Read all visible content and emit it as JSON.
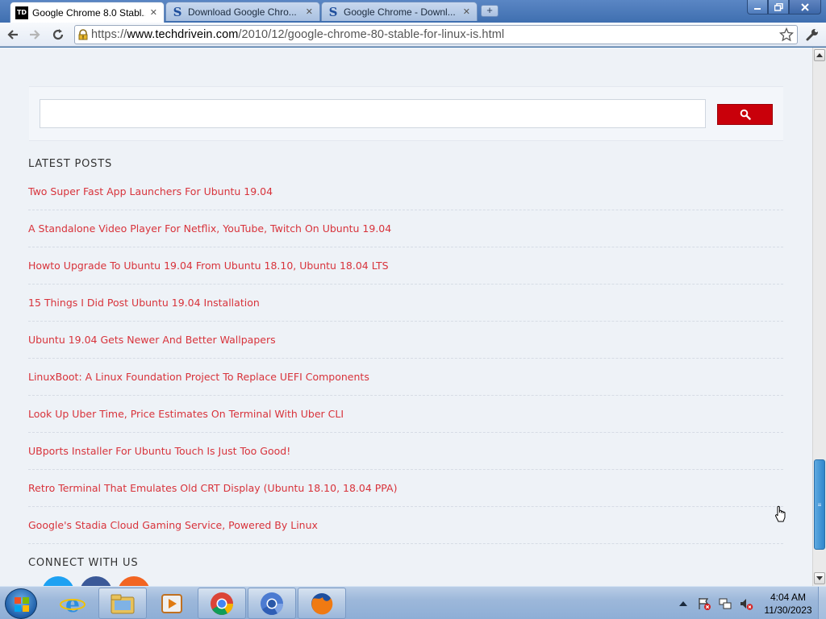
{
  "browser": {
    "tabs": [
      {
        "label": "Google Chrome 8.0 Stabl...",
        "favicon": "td-icon",
        "active": true
      },
      {
        "label": "Download Google Chro...",
        "favicon": "s-icon",
        "active": false
      },
      {
        "label": "Google Chrome - Downl...",
        "favicon": "s-icon",
        "active": false
      }
    ],
    "url_prefix": "https://",
    "url_host": "www.techdrivein.com",
    "url_path": "/2010/12/google-chrome-80-stable-for-linux-is.html"
  },
  "page": {
    "search": {
      "value": ""
    },
    "latest_posts_title": "LATEST POSTS",
    "posts": [
      "Two Super Fast App Launchers For Ubuntu 19.04",
      "A Standalone Video Player For Netflix, YouTube, Twitch On Ubuntu 19.04",
      "Howto Upgrade To Ubuntu 19.04 From Ubuntu 18.10, Ubuntu 18.04 LTS",
      "15 Things I Did Post Ubuntu 19.04 Installation",
      "Ubuntu 19.04 Gets Newer And Better Wallpapers",
      "LinuxBoot: A Linux Foundation Project To Replace UEFI Components",
      "Look Up Uber Time, Price Estimates On Terminal With Uber CLI",
      "UBports Installer For Ubuntu Touch Is Just Too Good!",
      "Retro Terminal That Emulates Old CRT Display (Ubuntu 18.10, 18.04 PPA)",
      "Google's Stadia Cloud Gaming Service, Powered By Linux"
    ],
    "connect_title": "CONNECT WITH US",
    "social": [
      {
        "name": "twitter",
        "color": "#1da1f2"
      },
      {
        "name": "facebook",
        "color": "#3b5998"
      },
      {
        "name": "rss",
        "color": "#f26522"
      }
    ]
  },
  "colors": {
    "link": "#d8333b",
    "search_button": "#c9000a",
    "page_bg": "#eef2f7"
  },
  "taskbar": {
    "pinned": [
      "internet-explorer",
      "windows-explorer",
      "media-player",
      "google-chrome",
      "chromium",
      "firefox"
    ],
    "time": "4:04 AM",
    "date": "11/30/2023"
  }
}
